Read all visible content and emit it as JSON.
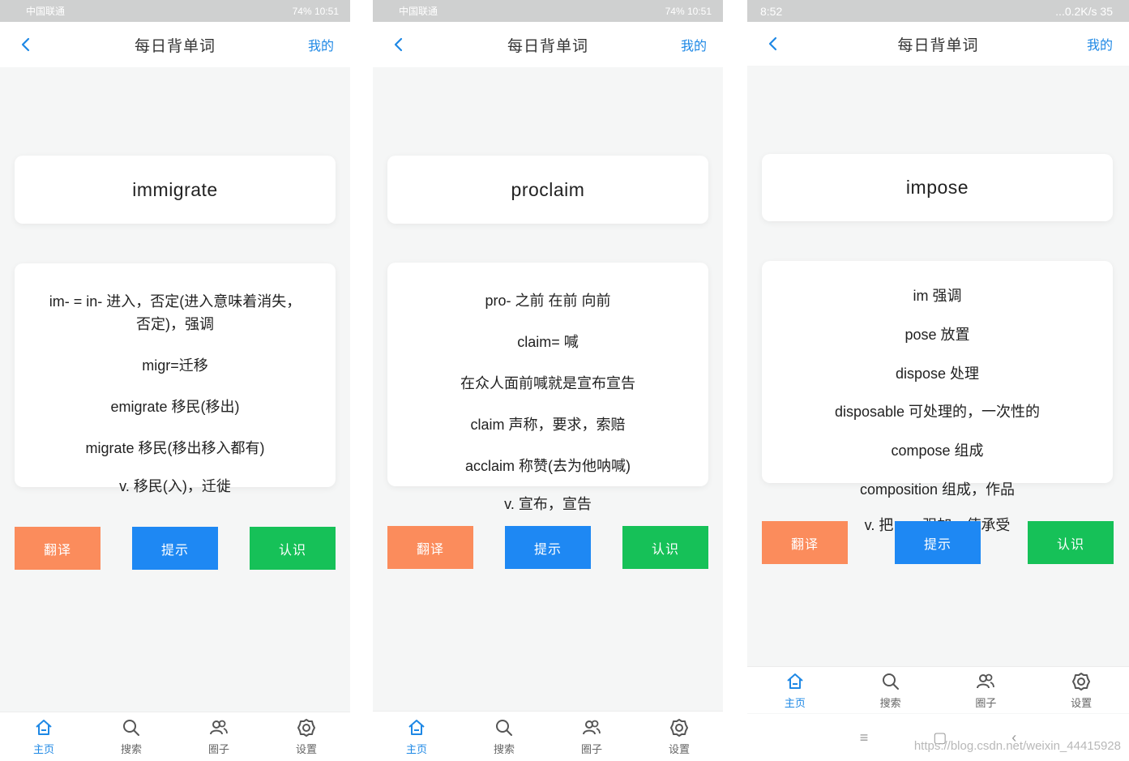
{
  "nav": {
    "title": "每日背单词",
    "mine": "我的"
  },
  "buttons": {
    "translate": "翻译",
    "hint": "提示",
    "know": "认识"
  },
  "tabs": [
    "主页",
    "搜索",
    "圈子",
    "设置"
  ],
  "screens": [
    {
      "status_left": "中国联通",
      "status_right": "74% 10:51",
      "word": "immigrate",
      "lines": [
        "im- = in- 进入，否定(进入意味着消失，",
        "否定)，强调",
        "migr=迁移",
        "emigrate 移民(移出)",
        "migrate 移民(移出移入都有)",
        "v. 移民(入)，迁徙"
      ]
    },
    {
      "status_left": "中国联通",
      "status_right": "74% 10:51",
      "word": "proclaim",
      "lines": [
        "pro- 之前 在前 向前",
        "claim= 喊",
        "在众人面前喊就是宣布宣告",
        "claim 声称，要求，索赔",
        "acclaim 称赞(去为他呐喊)",
        "v. 宣布，宣告"
      ]
    },
    {
      "status_left": "8:52",
      "status_right": "...0.2K/s 35",
      "word": "impose",
      "lines": [
        "im 强调",
        "pose 放置",
        "dispose 处理",
        "disposable 可处理的，一次性的",
        "compose 组成",
        "composition 组成，作品",
        "v. 把……强加，使承受"
      ]
    }
  ],
  "watermark": "https://blog.csdn.net/weixin_44415928",
  "colors": {
    "accent": "#1e88e5",
    "orange": "#fb8c5c",
    "blue": "#1e88f3",
    "green": "#16c158"
  }
}
